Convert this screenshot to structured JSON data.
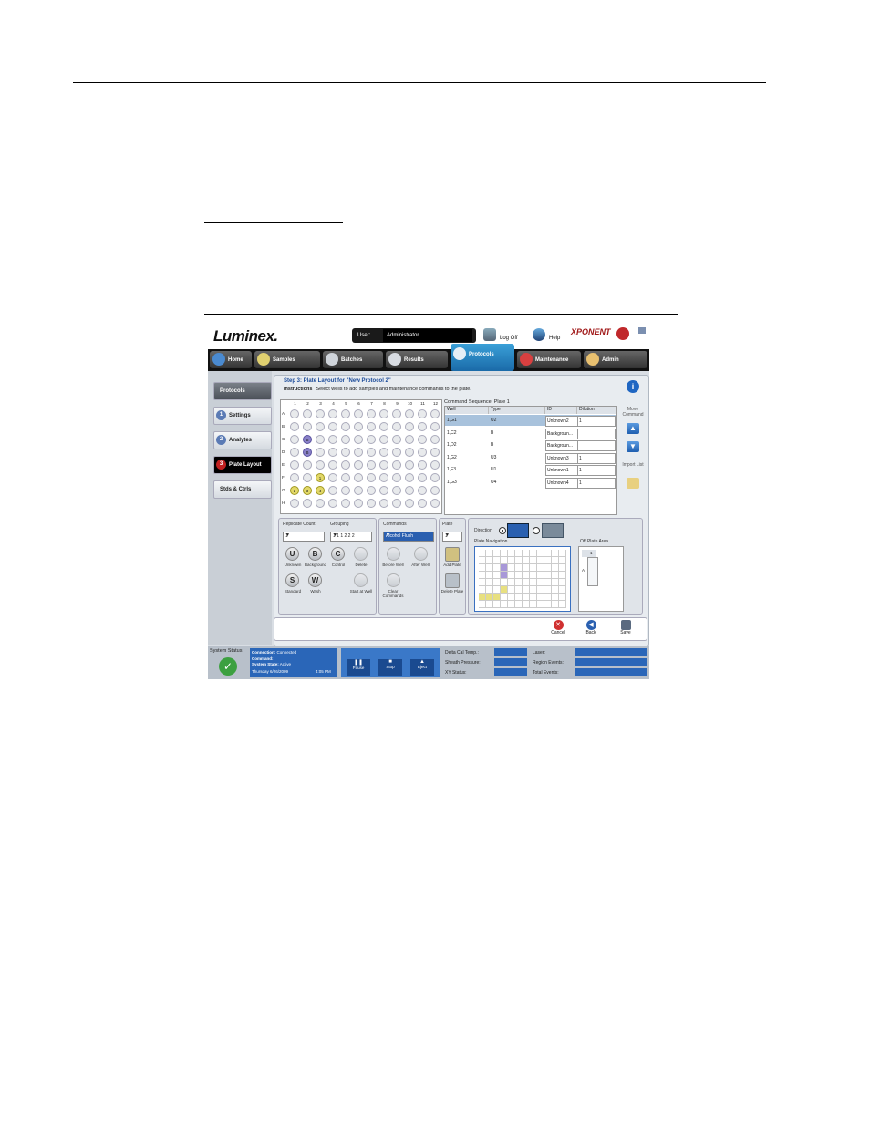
{
  "header": {
    "logo": "Luminex.",
    "user_label": "User:",
    "user_value": "Administrator",
    "logoff": "Log Off",
    "help": "Help",
    "brand": "XPONENT"
  },
  "tabs": [
    "Home",
    "Samples",
    "Batches",
    "Results",
    "Protocols",
    "Maintenance",
    "Admin"
  ],
  "leftnav": {
    "protocols": "Protocols",
    "items": [
      {
        "num": "1",
        "label": "Settings"
      },
      {
        "num": "2",
        "label": "Analytes"
      },
      {
        "num": "3",
        "label": "Plate Layout"
      },
      {
        "num": "",
        "label": "Stds & Ctrls"
      }
    ]
  },
  "main": {
    "step_title": "Step 3: Plate Layout for \"New Protocol 2\"",
    "instructions_label": "Instructions",
    "instructions_text": "Select wells to add samples and maintenance commands to the plate.",
    "plate": {
      "cols": [
        "1",
        "2",
        "3",
        "4",
        "5",
        "6",
        "7",
        "8",
        "9",
        "10",
        "11",
        "12"
      ],
      "rows": [
        "A",
        "B",
        "C",
        "D",
        "E",
        "F",
        "G",
        "H"
      ],
      "wells": {
        "C2": {
          "label": "B",
          "color": "purple"
        },
        "D2": {
          "label": "B",
          "color": "purple"
        },
        "F3": {
          "label": "1",
          "color": "yellow"
        },
        "G1": {
          "label": "2",
          "color": "yellow"
        },
        "G2": {
          "label": "3",
          "color": "yellow"
        },
        "G3": {
          "label": "4",
          "color": "yellow"
        }
      }
    },
    "command_sequence": {
      "title": "Command Sequence: Plate 1",
      "headers": [
        "Well",
        "Type",
        "ID",
        "Dilution"
      ],
      "rows": [
        {
          "well": "1,G1",
          "type": "U2",
          "id": "Unknown2",
          "dilution": "1"
        },
        {
          "well": "1,C2",
          "type": "B",
          "id": "Backgroun...",
          "dilution": ""
        },
        {
          "well": "1,D2",
          "type": "B",
          "id": "Backgroun...",
          "dilution": ""
        },
        {
          "well": "1,G2",
          "type": "U3",
          "id": "Unknown3",
          "dilution": "1"
        },
        {
          "well": "1,F3",
          "type": "U1",
          "id": "Unknown1",
          "dilution": "1"
        },
        {
          "well": "1,G3",
          "type": "U4",
          "id": "Unknown4",
          "dilution": "1"
        }
      ],
      "move_label": "Move Command",
      "import_label": "Import List"
    },
    "replicate": {
      "label": "Replicate Count",
      "value": "1",
      "grouping_label": "Grouping",
      "grouping_value": "1 1 1 2 2 2",
      "buttons": [
        {
          "glyph": "U",
          "label": "Unknown"
        },
        {
          "glyph": "B",
          "label": "Background"
        },
        {
          "glyph": "C",
          "label": "Control"
        },
        {
          "glyph": "",
          "label": "Delete"
        },
        {
          "glyph": "S",
          "label": "Standard"
        },
        {
          "glyph": "W",
          "label": "Wash"
        },
        {
          "glyph": "",
          "label": "Start at Well"
        }
      ]
    },
    "commands": {
      "label": "Commands",
      "value": "Alcohol Flush",
      "before": "Before Well",
      "after": "After Well",
      "clear": "Clear Commands"
    },
    "plate_panel": {
      "label": "Plate",
      "value": "1",
      "add": "Add Plate",
      "delete": "Delete Plate"
    },
    "direction": {
      "label": "Direction",
      "nav_label": "Plate Navigation",
      "off_plate": "Off Plate Area",
      "off_col": "1",
      "off_row": "A"
    },
    "footer": {
      "cancel": "Cancel",
      "back": "Back",
      "save": "Save"
    }
  },
  "status_bar": {
    "system_status": "System Status",
    "connection_label": "Connection:",
    "connection_value": "Connected",
    "command_label": "Command:",
    "state_label": "System State:",
    "state_value": "Active",
    "date": "Thursday 6/26/2009",
    "time": "4:05 PM",
    "buttons": [
      "Pause",
      "Stop",
      "Eject"
    ],
    "stats": [
      "Delta Cal Temp.:",
      "Sheath Pressure:",
      "XY Status:",
      "Laser:",
      "Region Events:",
      "Total Events:"
    ]
  }
}
